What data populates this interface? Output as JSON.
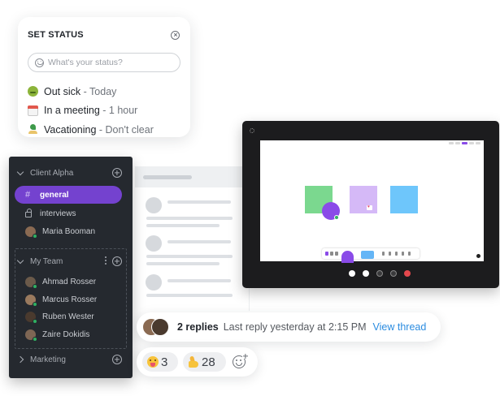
{
  "status_card": {
    "title": "SET STATUS",
    "input_placeholder": "What's your status?",
    "options": [
      {
        "icon": "sick-face-icon",
        "label": "Out sick",
        "duration": " - Today"
      },
      {
        "icon": "calendar-icon",
        "label": "In a meeting",
        "duration": " - 1 hour"
      },
      {
        "icon": "beach-icon",
        "label": "Vacationing",
        "duration": " - Don't clear"
      }
    ]
  },
  "sidebar": {
    "groups": [
      {
        "label": "Client Alpha"
      },
      {
        "label": "My Team"
      },
      {
        "label": "Marketing"
      }
    ],
    "channels": [
      {
        "prefix": "#",
        "label": "general",
        "active": true
      },
      {
        "prefix": "lock",
        "label": "interviews",
        "active": false
      }
    ],
    "direct": [
      {
        "label": "Maria Booman"
      }
    ],
    "team_members": [
      {
        "label": "Ahmad Rosser"
      },
      {
        "label": "Marcus Rosser"
      },
      {
        "label": "Ruben Wester"
      },
      {
        "label": "Zaire Dokidis"
      }
    ]
  },
  "thread": {
    "reply_count": "2 replies",
    "last_reply": "Last reply yesterday at 2:15 PM",
    "link": "View thread"
  },
  "reactions": [
    {
      "emoji": "stuck-out-tongue-icon",
      "count": "3"
    },
    {
      "emoji": "thumbs-up-icon",
      "count": "28"
    }
  ],
  "colors": {
    "accent": "#7442cf",
    "sidebar_bg": "#25292f",
    "link": "#2b8ce0",
    "online": "#2fb162",
    "sticky_green": "#7bd88f",
    "sticky_purple": "#d5b9f7",
    "sticky_blue": "#6ec6fb"
  }
}
